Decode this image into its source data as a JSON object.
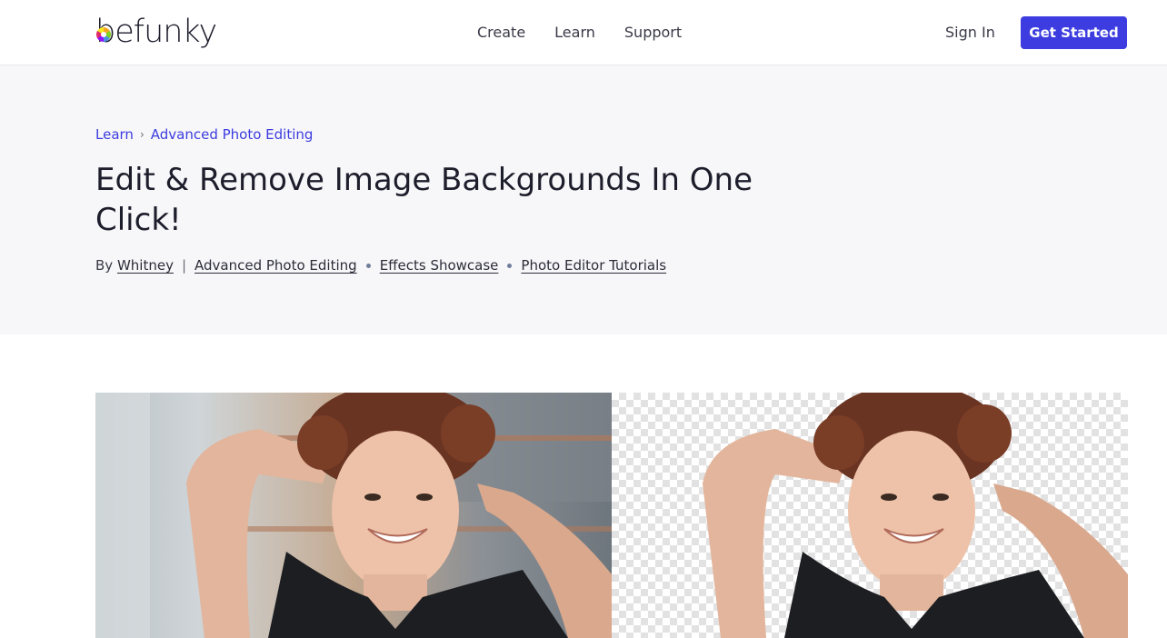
{
  "header": {
    "logo_text": "befunky",
    "nav": [
      {
        "label": "Create"
      },
      {
        "label": "Learn"
      },
      {
        "label": "Support"
      }
    ],
    "sign_in": "Sign In",
    "cta": "Get Started",
    "cta_color": "#3c3ce0"
  },
  "hero": {
    "breadcrumb": [
      {
        "label": "Learn"
      },
      {
        "label": "Advanced Photo Editing"
      }
    ],
    "title": "Edit & Remove Image Backgrounds In One Click!",
    "byline": {
      "prefix": "By",
      "author": "Whitney",
      "categories": [
        "Advanced Photo Editing",
        "Effects Showcase",
        "Photo Editor Tutorials"
      ]
    }
  },
  "images": {
    "left": {
      "icon": "photo-original"
    },
    "right": {
      "icon": "photo-background-removed"
    }
  }
}
